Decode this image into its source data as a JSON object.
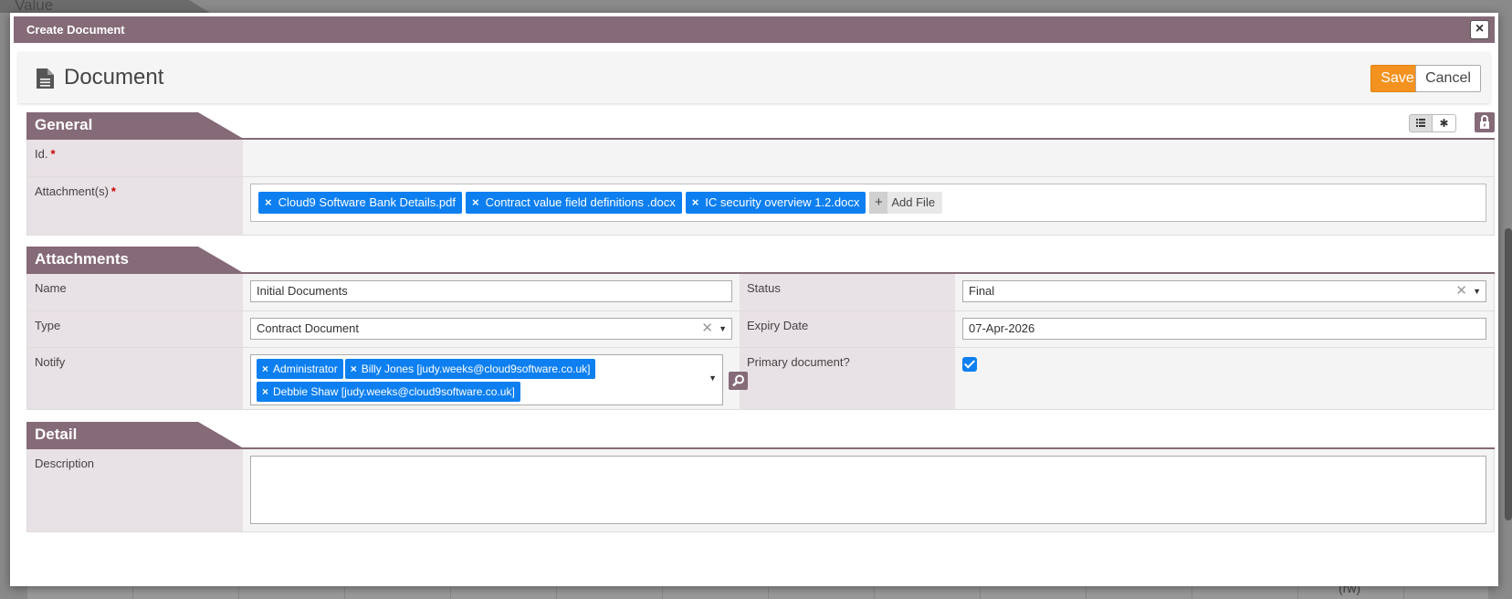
{
  "background": {
    "value_label": "Value",
    "rw_label": "(rw)"
  },
  "dialog": {
    "title": "Create Document",
    "close_label": "×"
  },
  "header": {
    "title": "Document",
    "icon": "document-icon",
    "save_label": "Save",
    "cancel_label": "Cancel"
  },
  "general": {
    "section_title": "General",
    "id_label": "Id.",
    "required_mark": "*",
    "attachments_label": "Attachment(s)",
    "files": [
      "Cloud9 Software Bank Details.pdf",
      "Contract value field definitions .docx",
      "IC security overview 1.2.docx"
    ],
    "remove_symbol": "×",
    "add_file_label": "Add File",
    "add_symbol": "+",
    "view_list_icon": "list-icon",
    "view_star_icon": "asterisk-icon",
    "lock_icon": "lock-icon"
  },
  "attachments": {
    "section_title": "Attachments",
    "name_label": "Name",
    "name_value": "Initial Documents",
    "status_label": "Status",
    "status_value": "Final",
    "type_label": "Type",
    "type_value": "Contract Document",
    "expiry_label": "Expiry Date",
    "expiry_value": "07-Apr-2026",
    "notify_label": "Notify",
    "notify_recipients": [
      "Administrator",
      "Billy Jones [judy.weeks@cloud9software.co.uk]",
      "Debbie Shaw [judy.weeks@cloud9software.co.uk]"
    ],
    "primary_label": "Primary document?",
    "primary_checked": true
  },
  "detail": {
    "section_title": "Detail",
    "description_label": "Description",
    "description_value": ""
  },
  "colors": {
    "brand": "#856a78",
    "accent": "#f4921f",
    "chip": "#0d7ff0"
  }
}
